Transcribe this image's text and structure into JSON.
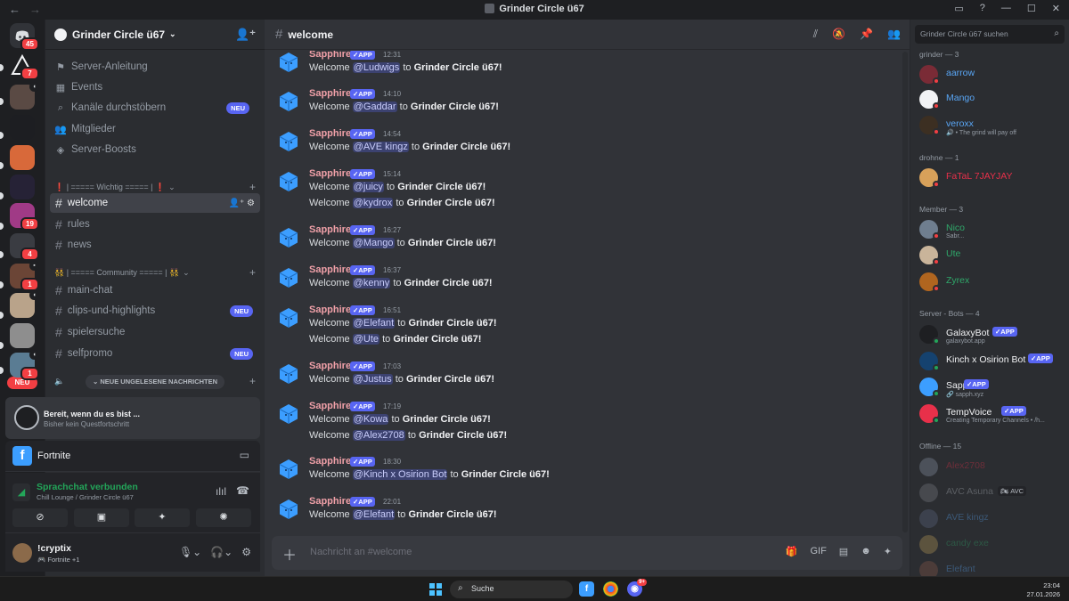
{
  "titlebar": {
    "title": "Grinder Circle ü67",
    "back": "←",
    "forward": "→",
    "btns": [
      "▭",
      "?",
      "—",
      "☐",
      "✕"
    ]
  },
  "rail": {
    "home_badge": "45",
    "neu": "NEU",
    "servers": [
      {
        "badge": "7",
        "color": "#2b2d31"
      },
      {
        "badge": "",
        "color": "#5a4a44",
        "spk": "◖"
      },
      {
        "badge": "",
        "color": "#1d1e22"
      },
      {
        "badge": "",
        "color": "#d8693a"
      },
      {
        "badge": "",
        "color": "#262236"
      },
      {
        "badge": "19",
        "color": "#a03a86"
      },
      {
        "badge": "4",
        "color": "#3a3c42"
      },
      {
        "badge": "1",
        "color": "#6b4536",
        "spk": "▪"
      },
      {
        "badge": "",
        "color": "#b9a38a",
        "spk": "◖"
      },
      {
        "badge": "",
        "color": "#8e8e8e"
      },
      {
        "badge": "1",
        "color": "#5a7c93",
        "spk": "◖"
      }
    ]
  },
  "guild": {
    "name": "Grinder Circle ü67"
  },
  "nav": [
    {
      "icon": "⚑",
      "label": "Server-Anleitung",
      "neu": ""
    },
    {
      "icon": "▦",
      "label": "Events",
      "neu": ""
    },
    {
      "icon": "⌕",
      "label": "Kanäle durchstöbern",
      "neu": "NEU"
    },
    {
      "icon": "👥",
      "label": "Mitglieder",
      "neu": ""
    },
    {
      "icon": "◈",
      "label": "Server-Boosts",
      "neu": ""
    }
  ],
  "categories": {
    "wichtig": "❗ | ===== Wichtig ===== | ❗",
    "community": "👯 | ===== Community ===== | 👯"
  },
  "channels": [
    {
      "label": "welcome",
      "neu": ""
    },
    {
      "label": "rules",
      "neu": ""
    },
    {
      "label": "news",
      "neu": ""
    },
    {
      "label": "main-chat",
      "neu": ""
    },
    {
      "label": "clips-und-highlights",
      "neu": "NEU"
    },
    {
      "label": "spielersuche",
      "neu": ""
    },
    {
      "label": "selfpromo",
      "neu": "NEU"
    }
  ],
  "newmsg": "NEUE UNGELESENE NACHRICHTEN",
  "quest": {
    "title": "Bereit, wenn du es bist ...",
    "sub": "Bisher kein Questfortschritt"
  },
  "game": {
    "name": "Fortnite",
    "icon": "f"
  },
  "voice": {
    "status": "Sprachchat verbunden",
    "channel": "Chill Lounge / Grinder Circle ü67"
  },
  "user": {
    "name": "!cryptix",
    "status": "🎮 Fortnite +1"
  },
  "channel": {
    "name": "welcome",
    "placeholder": "Nachricht an #welcome"
  },
  "messages": [
    {
      "time": "12:31",
      "lines": [
        {
          "mention": "@Ludwigs"
        }
      ]
    },
    {
      "time": "14:10",
      "lines": [
        {
          "mention": "@Gaddar"
        }
      ]
    },
    {
      "time": "14:54",
      "lines": [
        {
          "mention": "@AVE kingz"
        }
      ]
    },
    {
      "time": "15:14",
      "lines": [
        {
          "mention": "@juicy"
        },
        {
          "mention": "@kydrox"
        }
      ]
    },
    {
      "time": "16:27",
      "lines": [
        {
          "mention": "@Mango"
        }
      ]
    },
    {
      "time": "16:37",
      "lines": [
        {
          "mention": "@kenny"
        }
      ]
    },
    {
      "time": "16:51",
      "lines": [
        {
          "mention": "@Elefant"
        },
        {
          "mention": "@Ute"
        }
      ]
    },
    {
      "time": "17:03",
      "lines": [
        {
          "mention": "@Justus"
        }
      ]
    },
    {
      "time": "17:19",
      "lines": [
        {
          "mention": "@Kowa"
        },
        {
          "mention": "@Alex2708"
        }
      ]
    },
    {
      "time": "18:30",
      "lines": [
        {
          "mention": "@Kinch x Osirion Bot"
        }
      ]
    },
    {
      "time": "22:01",
      "lines": [
        {
          "mention": "@Elefant"
        }
      ]
    }
  ],
  "msg_common": {
    "author": "Sapphire",
    "app": "APP",
    "welcome": "Welcome",
    "to": "to",
    "server": "Grinder Circle ü67!"
  },
  "search": {
    "placeholder": "Grinder Circle ü67 suchen"
  },
  "members": {
    "groups": [
      "grinder — 3",
      "drohne — 1",
      "Member — 3",
      "Server - Bots — 4",
      "Offline — 15"
    ],
    "list": [
      {
        "name": "aarrow",
        "color": "#59a6f5",
        "sub": "",
        "app": "",
        "av": "#7a2b36",
        "st": "#f23f43"
      },
      {
        "name": "Mango",
        "color": "#59a6f5",
        "sub": "",
        "app": "",
        "av": "#f2f3f5",
        "st": "#f23f43"
      },
      {
        "name": "veroxx",
        "color": "#59a6f5",
        "sub": "🔊 • The grind will pay off",
        "app": "",
        "av": "#3c2f22",
        "st": "#f23f43"
      },
      {
        "name": "FaTaL 7JAYJAY",
        "color": "#e8304a",
        "sub": "",
        "app": "",
        "av": "#d8a15a",
        "st": "#f23f43"
      },
      {
        "name": "Nico",
        "color": "#2fa86a",
        "sub": "Sabr...",
        "app": "",
        "av": "#6f7e8f",
        "st": "#f23f43"
      },
      {
        "name": "Ute",
        "color": "#2fa86a",
        "sub": "",
        "app": "",
        "av": "#c9b49a",
        "st": "#f23f43"
      },
      {
        "name": "Zyrex",
        "color": "#2fa86a",
        "sub": "",
        "app": "",
        "av": "#b0651f",
        "st": "#f23f43"
      },
      {
        "name": "GalaxyBot",
        "color": "#f2f3f5",
        "sub": "galaxybot.app",
        "app": "APP",
        "av": "#1e1f22",
        "st": "#23a559"
      },
      {
        "name": "Kinch x Osirion Bot",
        "color": "#f2f3f5",
        "sub": "",
        "app": "APP",
        "av": "#15426f",
        "st": "#23a559"
      },
      {
        "name": "Sapphire",
        "color": "#f2f3f5",
        "sub": "🔗 sapph.xyz",
        "app": "APP",
        "av": "#3c9eff",
        "st": "#23a559"
      },
      {
        "name": "TempVoice",
        "color": "#f2f3f5",
        "sub": "Creating Temporary Channels • /h...",
        "app": "APP",
        "av": "#e8304a",
        "st": "#23a559"
      },
      {
        "name": "Alex2708",
        "color": "#e8304a",
        "sub": "",
        "app": "",
        "av": "#8a96a8",
        "st": ""
      },
      {
        "name": "AVC Asuna",
        "color": "#b5bac1",
        "sub": "",
        "app": "",
        "av": "#7a7f86",
        "st": "",
        "tag": "🏍 AVC"
      },
      {
        "name": "AVE kingz",
        "color": "#59a6f5",
        "sub": "",
        "app": "",
        "av": "#5b6784",
        "st": ""
      },
      {
        "name": "candy exe",
        "color": "#2fa86a",
        "sub": "",
        "app": "",
        "av": "#b89a58",
        "st": ""
      },
      {
        "name": "Elefant",
        "color": "#59a6f5",
        "sub": "",
        "app": "",
        "av": "#8a5a4a",
        "st": ""
      }
    ]
  },
  "taskbar": {
    "search": "Suche",
    "time": "23:04",
    "date": "27.01.2026",
    "discord_badge": "9+"
  }
}
